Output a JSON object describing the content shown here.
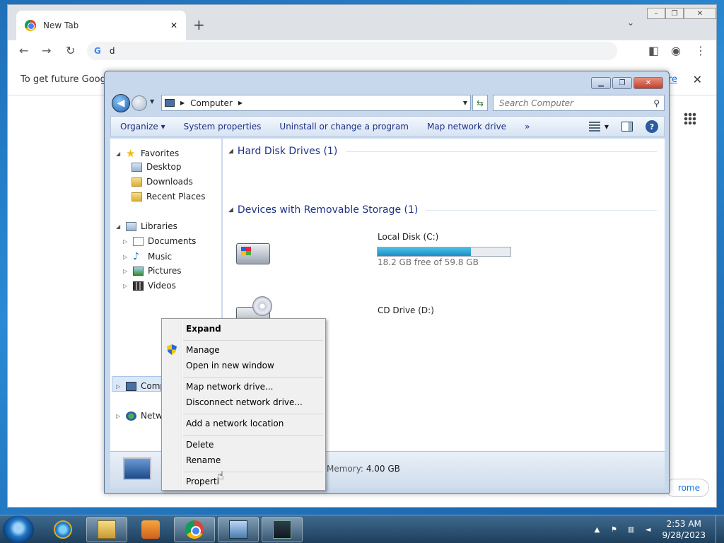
{
  "chrome": {
    "tab_title": "New Tab",
    "omnibox_value": "d",
    "omnibox_g": "G",
    "infobar_text": "To get future Google",
    "infobar_link": "ore",
    "bg_button": "rome"
  },
  "explorer": {
    "address_crumb": "Computer",
    "search_placeholder": "Search Computer",
    "commands": [
      "Organize ▾",
      "System properties",
      "Uninstall or change a program",
      "Map network drive",
      "»"
    ],
    "nav": {
      "favorites": "Favorites",
      "desktop": "Desktop",
      "downloads": "Downloads",
      "recent": "Recent Places",
      "libraries": "Libraries",
      "documents": "Documents",
      "music": "Music",
      "pictures": "Pictures",
      "videos": "Videos",
      "computer": "Computer",
      "network": "Netwo"
    },
    "groups": {
      "hdd": "Hard Disk Drives (1)",
      "removable": "Devices with Removable Storage (1)"
    },
    "drives": {
      "c_name": "Local Disk (C:)",
      "c_free": "18.2 GB free of 59.8 GB",
      "c_used_fraction": 0.7,
      "d_name": "CD Drive (D:)"
    },
    "details": {
      "memory_label": "Memory:",
      "memory_value": "4.00 GB"
    }
  },
  "context_menu": {
    "expand": "Expand",
    "manage": "Manage",
    "open_new": "Open in new window",
    "map_drive": "Map network drive...",
    "disconnect": "Disconnect network drive...",
    "add_location": "Add a network location",
    "delete": "Delete",
    "rename": "Rename",
    "properties": "Properti"
  },
  "taskbar": {
    "time": "2:53 AM",
    "date": "9/28/2023"
  }
}
